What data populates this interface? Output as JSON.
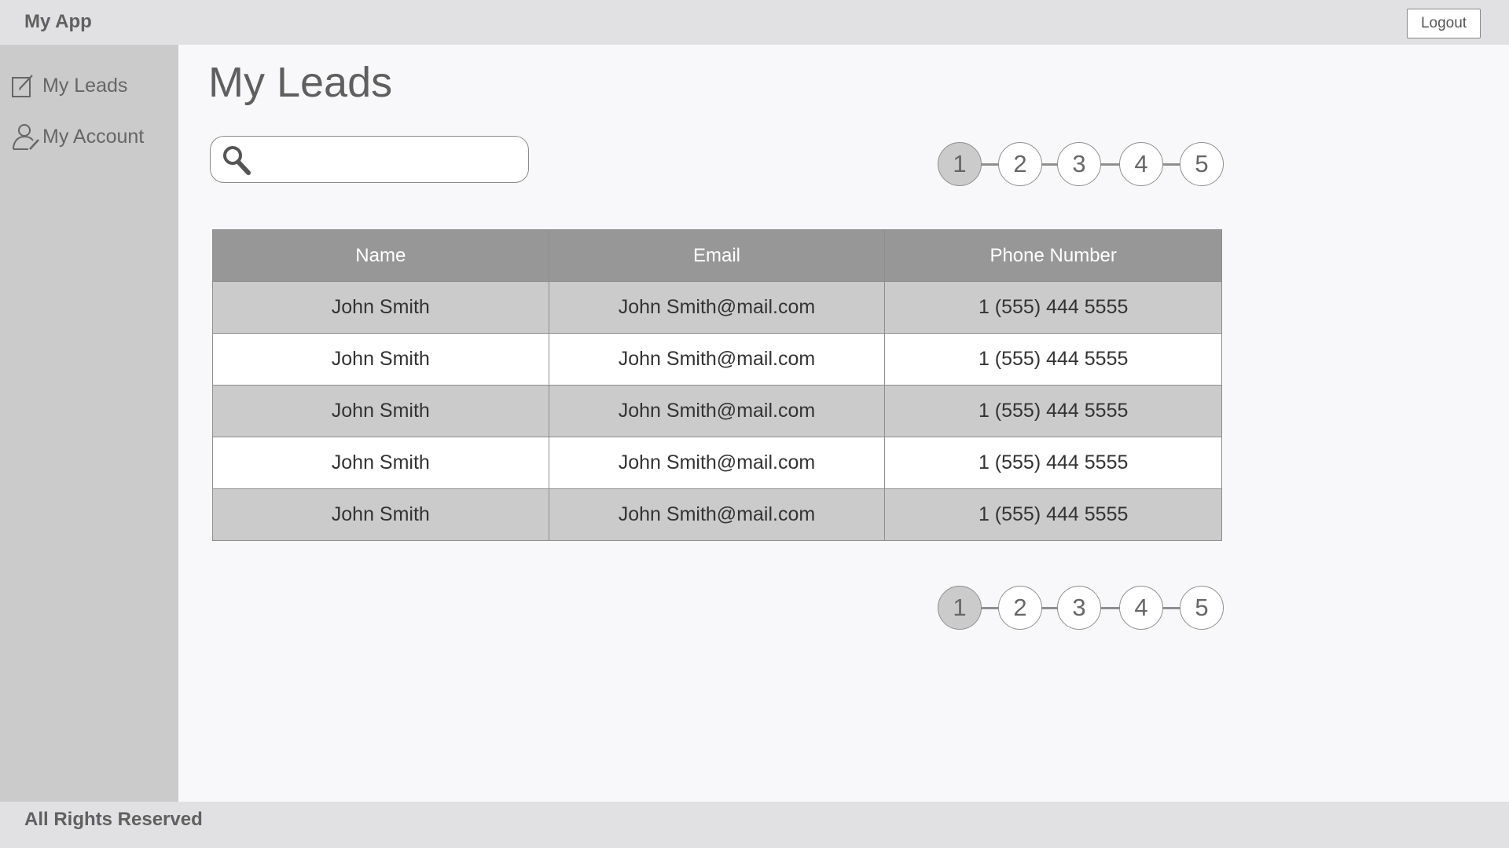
{
  "header": {
    "app_title": "My App",
    "logout_label": "Logout"
  },
  "sidebar": {
    "items": [
      {
        "label": "My Leads",
        "icon": "edit-icon"
      },
      {
        "label": "My Account",
        "icon": "user-edit-icon"
      }
    ]
  },
  "main": {
    "page_title": "My Leads",
    "search": {
      "value": "",
      "placeholder": ""
    },
    "pagination": {
      "pages": [
        "1",
        "2",
        "3",
        "4",
        "5"
      ],
      "current": "1"
    },
    "table": {
      "columns": [
        "Name",
        "Email",
        "Phone Number"
      ],
      "rows": [
        [
          "John Smith",
          "John Smith@mail.com",
          "1 (555) 444 5555"
        ],
        [
          "John Smith",
          "John Smith@mail.com",
          "1 (555) 444 5555"
        ],
        [
          "John Smith",
          "John Smith@mail.com",
          "1 (555) 444 5555"
        ],
        [
          "John Smith",
          "John Smith@mail.com",
          "1 (555) 444 5555"
        ],
        [
          "John Smith",
          "John Smith@mail.com",
          "1 (555) 444 5555"
        ]
      ]
    }
  },
  "footer": {
    "text": "All Rights Reserved"
  },
  "colors": {
    "header_bg": "#e1e0e2",
    "sidebar_bg": "#cbcbcb",
    "table_header_bg": "#979797",
    "row_alt_bg": "#cbcbcb",
    "active_page_bg": "#cbcbcb"
  }
}
